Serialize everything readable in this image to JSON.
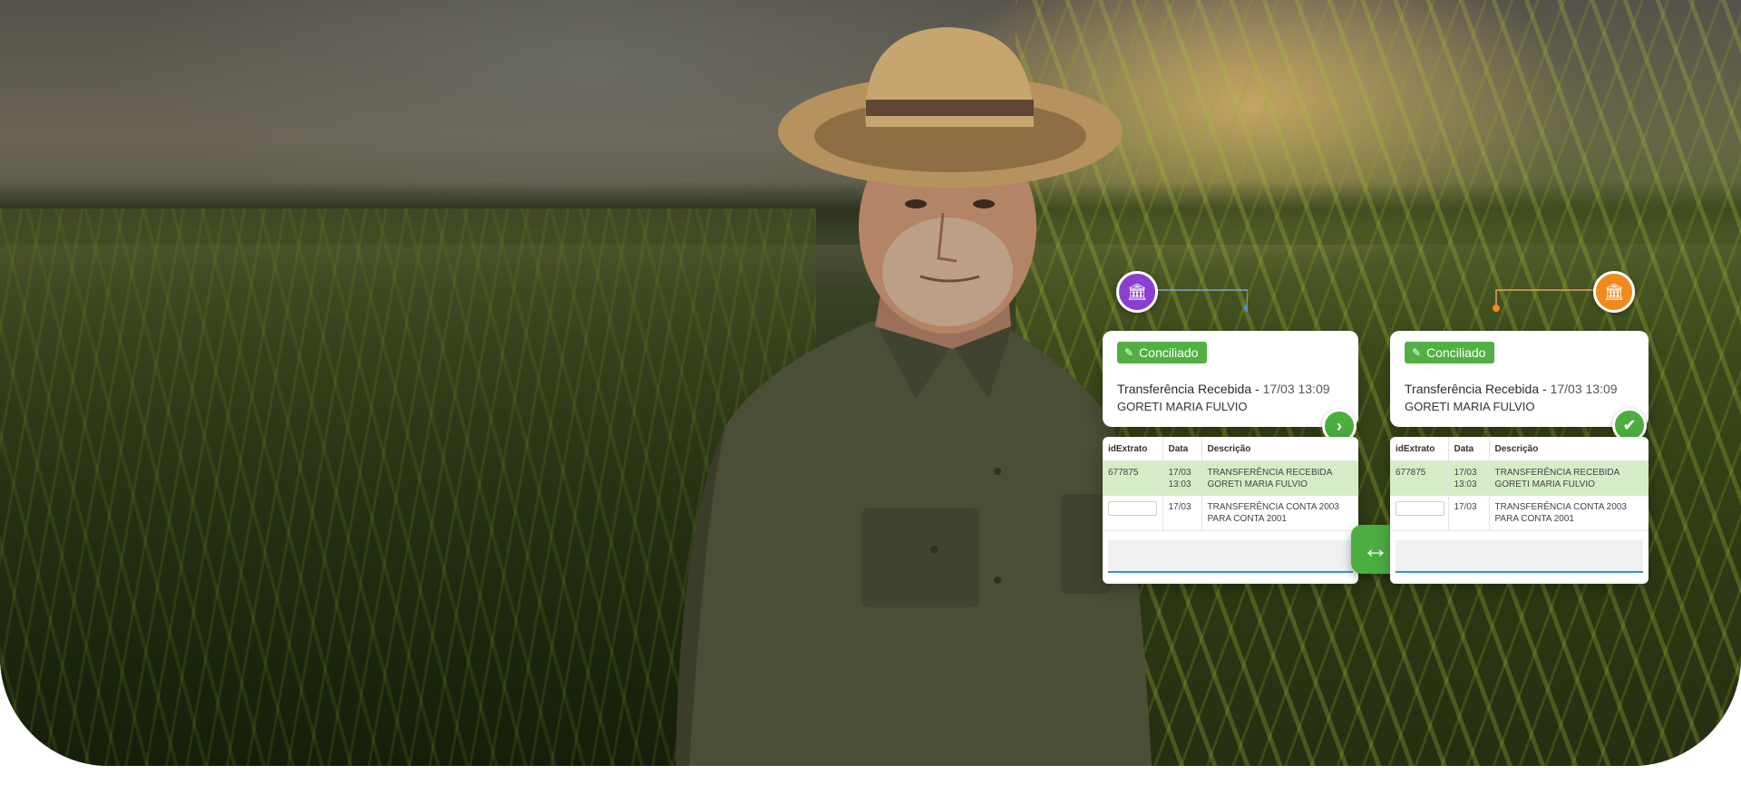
{
  "colors": {
    "accent_green": "#52b043",
    "left_bank_purple": "#8a3fd1",
    "right_bank_orange": "#f08a1c",
    "highlight_row": "#d6ecc7"
  },
  "left_panel": {
    "bank_icon": "bank-icon",
    "badge": "Conciliado",
    "transaction_title": "Transferência Recebida",
    "separator": " - ",
    "transaction_datetime": "17/03 13:09",
    "payer_name": "GORETI MARIA FULVIO",
    "status_icon": "chevron-right-icon",
    "table": {
      "headers": [
        "idExtrato",
        "Data",
        "Descrição"
      ],
      "rows": [
        {
          "id": "677875",
          "date": "17/03 13:03",
          "description": "TRANSFERÊNCIA RECEBIDA GORETI MARIA FULVIO"
        },
        {
          "id": "",
          "date": "17/03",
          "description": "TRANSFERÊNCIA  CONTA 2003 PARA CONTA 2001"
        }
      ]
    }
  },
  "right_panel": {
    "bank_icon": "bank-icon",
    "badge": "Conciliado",
    "transaction_title": "Transferência Recebida",
    "separator": " - ",
    "transaction_datetime": "17/03 13:09",
    "payer_name": "GORETI MARIA FULVIO",
    "status_icon": "shield-check-icon",
    "table": {
      "headers": [
        "idExtrato",
        "Data",
        "Descrição"
      ],
      "rows": [
        {
          "id": "677875",
          "date": "17/03 13:03",
          "description": "TRANSFERÊNCIA   RECEBIDA GORETI MARIA FULVIO"
        },
        {
          "id": "",
          "date": "17/03",
          "description": "TRANSFERÊNCIA  CONTA 2003 PARA CONTA 2001"
        }
      ]
    }
  },
  "swap_button_icon": "swap-arrows-icon"
}
